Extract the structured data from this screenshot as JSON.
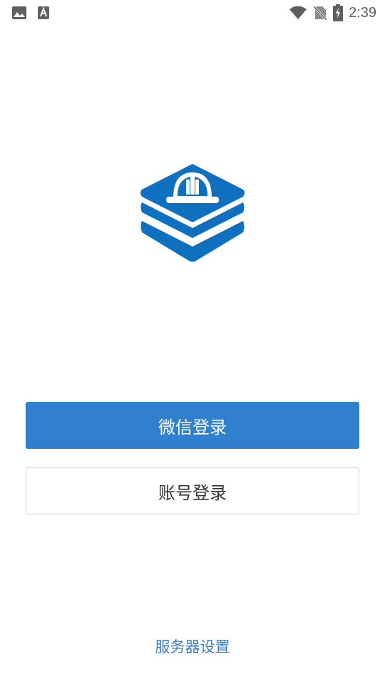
{
  "status_bar": {
    "time": "2:39",
    "icons": [
      "image-icon",
      "font-download-icon",
      "wifi-icon",
      "no-sim-icon",
      "battery-charging-icon"
    ]
  },
  "logo": {
    "icon": "helmet-layers-logo",
    "color": "#1070c0"
  },
  "login": {
    "wechat_label": "微信登录",
    "account_label": "账号登录"
  },
  "footer": {
    "server_settings_label": "服务器设置"
  },
  "colors": {
    "primary": "#3180cf",
    "link": "#3a7fc6",
    "logo": "#1070c0"
  }
}
